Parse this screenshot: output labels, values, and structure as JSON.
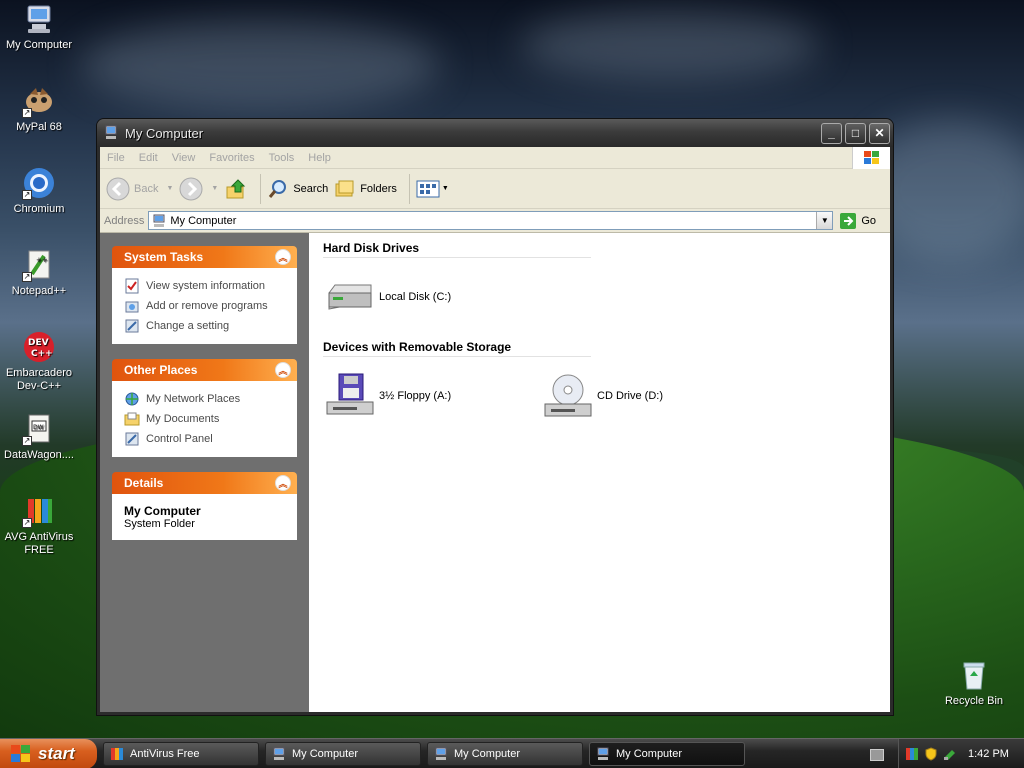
{
  "desktop": {
    "icons": [
      {
        "label": "My Computer",
        "icon": "my-computer-icon"
      },
      {
        "label": "MyPal 68",
        "icon": "mypal-icon"
      },
      {
        "label": "Chromium",
        "icon": "chromium-icon"
      },
      {
        "label": "Notepad++",
        "icon": "notepad-plus-plus-icon"
      },
      {
        "label": "Embarcadero Dev-C++",
        "icon": "dev-cpp-icon",
        "badge": "DEV C++"
      },
      {
        "label": "DataWagon....",
        "icon": "datawagon-icon"
      },
      {
        "label": "AVG AntiVirus FREE",
        "icon": "avg-icon"
      },
      {
        "label": "Recycle Bin",
        "icon": "recycle-bin-icon"
      }
    ]
  },
  "window": {
    "title": "My Computer",
    "controls": {
      "minimize": "_",
      "maximize": "□",
      "close": "✕"
    },
    "menu": [
      "File",
      "Edit",
      "View",
      "Favorites",
      "Tools",
      "Help"
    ],
    "toolbar": {
      "back": "Back",
      "search": "Search",
      "folders": "Folders"
    },
    "address": {
      "label": "Address",
      "value": "My Computer",
      "go": "Go"
    },
    "tasks": {
      "system_tasks": {
        "title": "System Tasks",
        "links": [
          "View system information",
          "Add or remove programs",
          "Change a setting"
        ]
      },
      "other_places": {
        "title": "Other Places",
        "links": [
          "My Network Places",
          "My Documents",
          "Control Panel"
        ]
      },
      "details": {
        "title": "Details",
        "name": "My Computer",
        "type": "System Folder"
      }
    },
    "groups": {
      "hard_disks": {
        "title": "Hard Disk Drives",
        "items": [
          "Local Disk (C:)"
        ]
      },
      "removable": {
        "title": "Devices with Removable Storage",
        "items": [
          "3½ Floppy (A:)",
          "CD Drive (D:)"
        ]
      }
    }
  },
  "taskbar": {
    "start": "start",
    "tasks": [
      {
        "label": "AntiVirus Free",
        "active": false
      },
      {
        "label": "My Computer",
        "active": false
      },
      {
        "label": "My Computer",
        "active": false
      },
      {
        "label": "My Computer",
        "active": true
      }
    ],
    "clock": "1:42 PM"
  },
  "colors": {
    "task_header": "#e0540e",
    "taskpane_bg": "#6f6f6f",
    "title_bg": "#3b3b3b"
  }
}
